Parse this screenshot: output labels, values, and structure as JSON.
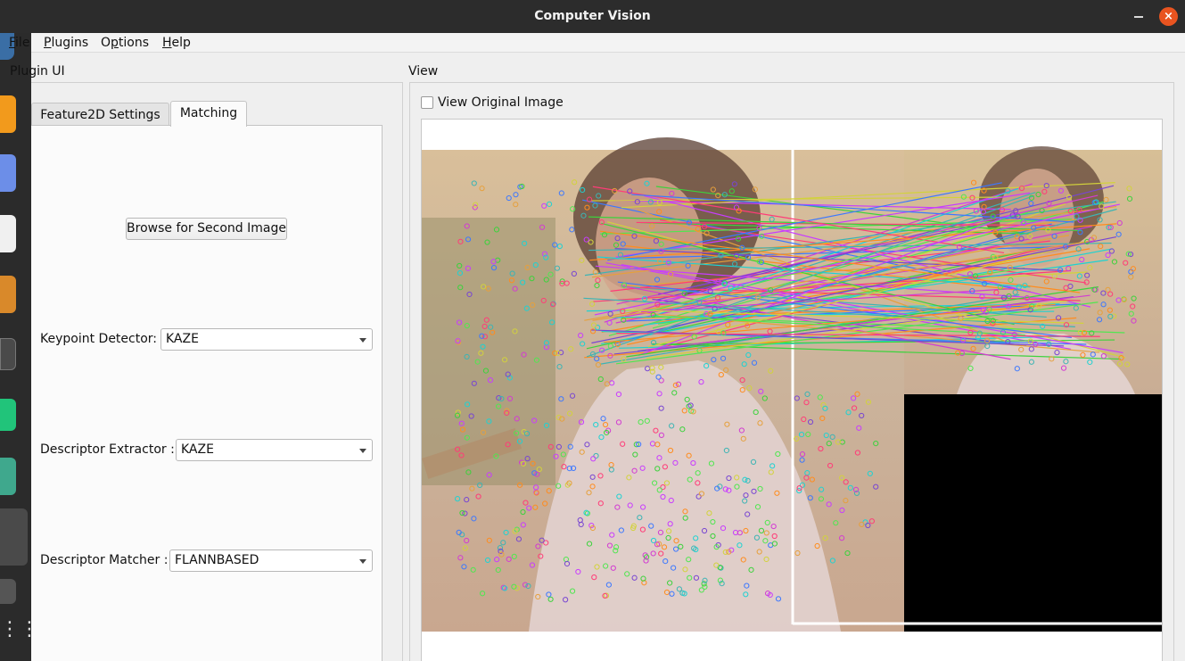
{
  "window": {
    "title": "Computer Vision",
    "close_glyph": "×"
  },
  "menu": {
    "items": [
      {
        "label": "File",
        "mnemonic": "F"
      },
      {
        "label": "Plugins",
        "mnemonic": "P"
      },
      {
        "label": "Options",
        "mnemonic": "p"
      },
      {
        "label": "Help",
        "mnemonic": "H"
      }
    ]
  },
  "plugin_panel": {
    "label": "Plugin UI",
    "tabs": [
      {
        "label": "Feature2D Settings",
        "active": false
      },
      {
        "label": "Matching",
        "active": true
      }
    ],
    "browse_button": "Browse for Second Image",
    "keypoint_detector": {
      "label": "Keypoint Detector:",
      "value": "KAZE"
    },
    "descriptor_extractor": {
      "label": "Descriptor Extractor :",
      "value": "KAZE"
    },
    "descriptor_matcher": {
      "label": "Descriptor Matcher :",
      "value": "FLANNBASED"
    }
  },
  "view_panel": {
    "label": "View",
    "view_original": {
      "label": "View Original Image",
      "checked": false
    }
  },
  "dock": {
    "icons": [
      "app-icon",
      "sublime-icon",
      "bluetooth-icon",
      "text-editor-icon",
      "terminal-icon",
      "disk-icon",
      "pycharm-icon",
      "stack-icon",
      "blank-app-icon",
      "usb-drive-icon",
      "show-apps-icon"
    ]
  },
  "colors": {
    "titlebar": "#2c2c2c",
    "dock": "#2b2b2b",
    "close_button": "#e95420",
    "panel_bg": "#efefef"
  }
}
